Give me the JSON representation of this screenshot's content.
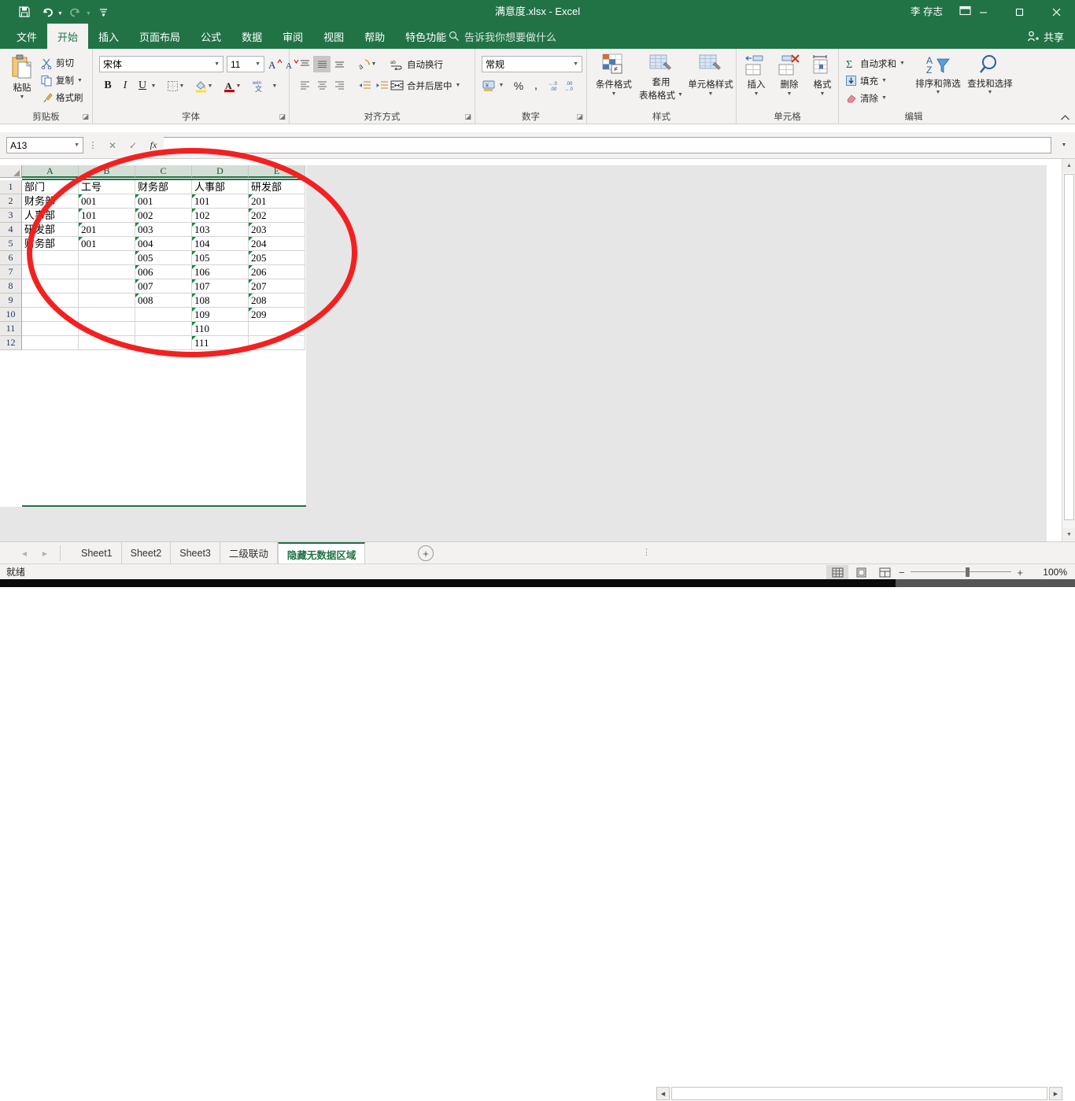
{
  "titlebar": {
    "document_title": "满意度.xlsx  -  Excel",
    "account_name": "李 存志",
    "quick_access": [
      {
        "name": "save",
        "glyph": "ὋE"
      },
      {
        "name": "undo",
        "glyph": "↶"
      },
      {
        "name": "redo",
        "glyph": "↷"
      },
      {
        "name": "customize",
        "glyph": "≡"
      }
    ],
    "window_controls": {
      "minimize": "—",
      "maximize": "❐",
      "close": "✕"
    },
    "ribbon_display_options": "❐"
  },
  "ribbon_tabs": [
    {
      "label": "文件",
      "active": false
    },
    {
      "label": "开始",
      "active": true
    },
    {
      "label": "插入",
      "active": false
    },
    {
      "label": "页面布局",
      "active": false
    },
    {
      "label": "公式",
      "active": false
    },
    {
      "label": "数据",
      "active": false
    },
    {
      "label": "审阅",
      "active": false
    },
    {
      "label": "视图",
      "active": false
    },
    {
      "label": "帮助",
      "active": false
    },
    {
      "label": "特色功能",
      "active": false
    }
  ],
  "tell_me": {
    "placeholder": "告诉我你想要做什么",
    "icon": "search-icon"
  },
  "share": {
    "label": "共享",
    "icon": "person-add-icon"
  },
  "ribbon": {
    "clipboard": {
      "group_label": "剪贴板",
      "paste_label": "粘贴",
      "cut_label": "剪切",
      "copy_label": "复制",
      "format_painter_label": "格式刷"
    },
    "font": {
      "group_label": "字体",
      "font_name": "宋体",
      "font_size": "11",
      "grow_font": "A",
      "shrink_font": "A",
      "bold": "B",
      "italic": "I",
      "underline": "U",
      "borders": "borders-icon",
      "fill_color": "fill-color-icon",
      "font_color": "font-color-icon",
      "phonetic": "wén\n文"
    },
    "alignment": {
      "group_label": "对齐方式",
      "wrap_text_label": "自动换行",
      "merge_center_label": "合并后居中",
      "orientation": "orientation-icon",
      "decrease_indent": "decrease-indent-icon",
      "increase_indent": "increase-indent-icon"
    },
    "number": {
      "group_label": "数字",
      "format_value": "常规",
      "accounting": "accounting-icon",
      "percent": "%",
      "comma": ",",
      "increase_decimal": ".00\n→",
      "decrease_decimal": "←\n.00"
    },
    "styles": {
      "group_label": "样式",
      "items": [
        {
          "label": "条件格式"
        },
        {
          "label": "套用\n表格格式"
        },
        {
          "label": "单元格样式"
        }
      ]
    },
    "cells": {
      "group_label": "单元格",
      "items": [
        {
          "label": "插入"
        },
        {
          "label": "删除"
        },
        {
          "label": "格式"
        }
      ]
    },
    "editing": {
      "group_label": "编辑",
      "autosum_label": "自动求和",
      "fill_label": "填充",
      "clear_label": "清除",
      "sort_filter_label": "排序和筛选",
      "find_select_label": "查找和选择"
    }
  },
  "formula_bar": {
    "name_box_value": "A13",
    "formula_value": "",
    "cancel_icon": "✕",
    "enter_icon": "✓",
    "function_icon": "fx"
  },
  "grid": {
    "column_headers": [
      "A",
      "B",
      "C",
      "D",
      "E"
    ],
    "row_headers": [
      "1",
      "2",
      "3",
      "4",
      "5",
      "6",
      "7",
      "8",
      "9",
      "10",
      "11",
      "12"
    ],
    "selected_cell": "A13",
    "rows": [
      {
        "A": "部门",
        "B": "工号",
        "C": "财务部",
        "D": "人事部",
        "E": "研发部"
      },
      {
        "A": "财务部",
        "B": "001",
        "C": "001",
        "D": "101",
        "E": "201"
      },
      {
        "A": "人事部",
        "B": "101",
        "C": "002",
        "D": "102",
        "E": "202"
      },
      {
        "A": "研发部",
        "B": "201",
        "C": "003",
        "D": "103",
        "E": "203"
      },
      {
        "A": "财务部",
        "B": "001",
        "C": "004",
        "D": "104",
        "E": "204"
      },
      {
        "A": "",
        "B": "",
        "C": "005",
        "D": "105",
        "E": "205"
      },
      {
        "A": "",
        "B": "",
        "C": "006",
        "D": "106",
        "E": "206"
      },
      {
        "A": "",
        "B": "",
        "C": "007",
        "D": "107",
        "E": "207"
      },
      {
        "A": "",
        "B": "",
        "C": "008",
        "D": "108",
        "E": "208"
      },
      {
        "A": "",
        "B": "",
        "C": "",
        "D": "109",
        "E": "209"
      },
      {
        "A": "",
        "B": "",
        "C": "",
        "D": "110",
        "E": ""
      },
      {
        "A": "",
        "B": "",
        "C": "",
        "D": "111",
        "E": ""
      }
    ],
    "error_flag_cells": [
      "B2",
      "B3",
      "B4",
      "B5",
      "C2",
      "C3",
      "C4",
      "C5",
      "C6",
      "C7",
      "C8",
      "C9",
      "D2",
      "D3",
      "D4",
      "D5",
      "D6",
      "D7",
      "D8",
      "D9",
      "D10",
      "D11",
      "D12",
      "E2",
      "E3",
      "E4",
      "E5",
      "E6",
      "E7",
      "E8",
      "E9",
      "E10"
    ]
  },
  "sheet_tabs": {
    "prev_icon": "◂",
    "next_icon": "▸",
    "tabs": [
      {
        "label": "Sheet1",
        "active": false
      },
      {
        "label": "Sheet2",
        "active": false
      },
      {
        "label": "Sheet3",
        "active": false
      },
      {
        "label": "二级联动",
        "active": false
      },
      {
        "label": "隐藏无数据区域",
        "active": true
      }
    ],
    "add_sheet_icon": "+"
  },
  "status_bar": {
    "state_text": "就绪",
    "view_buttons": [
      {
        "name": "normal-view",
        "active": true
      },
      {
        "name": "page-layout-view",
        "active": false
      },
      {
        "name": "page-break-view",
        "active": false
      }
    ],
    "zoom_out": "−",
    "zoom_in": "+",
    "zoom_level": "100%"
  },
  "annotation": {
    "shape": "ellipse",
    "color": "#f42020"
  },
  "colors": {
    "brand_green": "#217346",
    "ribbon_bg": "#f3f2f1",
    "grid_line": "#d4d4d4",
    "header_bg": "#eceae8",
    "error_flag": "#0b8a3d",
    "annotation_red": "#f42020"
  }
}
